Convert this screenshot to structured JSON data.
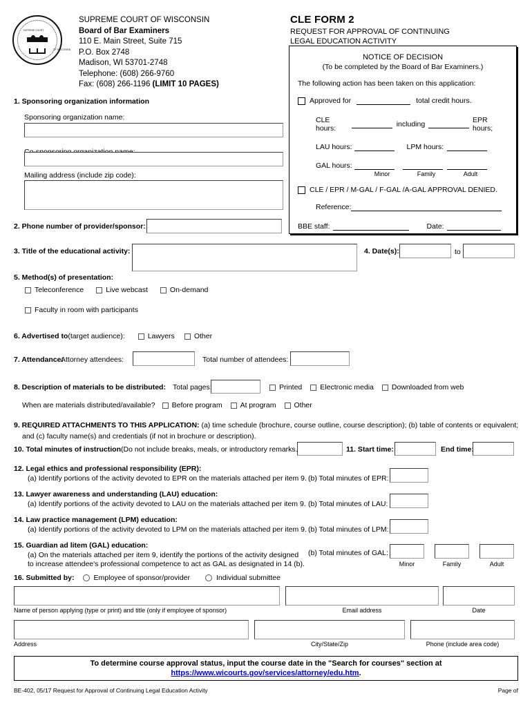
{
  "header": {
    "seal_text_top": "SUPREME COURT",
    "seal_text_bottom": "OF WISCONSIN",
    "court": "SUPREME COURT OF WISCONSIN",
    "board": "Board of Bar Examiners",
    "address1": "110 E. Main Street, Suite 715",
    "address2": "P.O. Box 2748",
    "address3": "Madison, WI  53701-2748",
    "phone": "Telephone: (608) 266-9760",
    "fax": "Fax: (608) 266-1196 ",
    "fax_bold": "(LIMIT 10 PAGES)",
    "form_number": "CLE FORM 2",
    "form_sub1": "REQUEST FOR APPROVAL OF CONTINUING",
    "form_sub2": "LEGAL EDUCATION ACTIVITY"
  },
  "notice": {
    "title": "NOTICE OF DECISION",
    "subtitle": "(To be completed by the Board of Bar Examiners.)",
    "lead": "The following action has been taken on this application:",
    "approved_label": "Approved for",
    "approved_suffix": "total credit hours.",
    "cle_hours_label": "CLE hours:",
    "including_label": "including",
    "epr_hours_label": "EPR hours;",
    "lau_hours_label": "LAU hours:",
    "lpm_hours_label": "LPM hours:",
    "gal_hours_label": "GAL hours:",
    "gal_minor": "Minor",
    "gal_family": "Family",
    "gal_adult": "Adult",
    "denied_label": "CLE / EPR / M-GAL / F-GAL /A-GAL APPROVAL DENIED.",
    "reference_label": "Reference:",
    "bbe_staff_label": "BBE staff:",
    "date_label": "Date:"
  },
  "s1": {
    "heading": "1. Sponsoring organization information",
    "sponsor_label": "Sponsoring organization name:",
    "sponsor_value": "",
    "cosponsor_label": "Co-sponsoring organization name:",
    "cosponsor_value": "",
    "mailing_label": "Mailing address (include zip code):",
    "mailing_value": ""
  },
  "s2": {
    "label": "2. Phone number of provider/sponsor:",
    "value": ""
  },
  "s3": {
    "label": "3. Title of the educational activity:",
    "value": ""
  },
  "s4": {
    "label": "4. Date(s):",
    "from_value": "",
    "to_label": "to",
    "to_value": ""
  },
  "s5": {
    "heading": "5. Method(s) of presentation:",
    "options": [
      {
        "label": "Teleconference",
        "checked": false
      },
      {
        "label": "Live webcast",
        "checked": false
      },
      {
        "label": "On-demand",
        "checked": false
      },
      {
        "label": "Faculty in room with participants",
        "checked": false
      }
    ]
  },
  "s6": {
    "heading": "6. Advertised to ",
    "heading_rest": "(target audience):",
    "options": [
      {
        "label": "Lawyers",
        "checked": false
      },
      {
        "label": "Other",
        "checked": false
      }
    ]
  },
  "s7": {
    "heading": "7. Attendance:",
    "attorney_label": "Attorney attendees:",
    "attorney_value": "",
    "total_label": "Total number of attendees:",
    "total_value": ""
  },
  "s8": {
    "heading": "8. Description of materials to be distributed:",
    "pages_label": "Total pages:",
    "pages_value": "",
    "format_options": [
      {
        "label": "Printed",
        "checked": false
      },
      {
        "label": "Electronic media",
        "checked": false
      },
      {
        "label": "Downloaded from web",
        "checked": false
      }
    ],
    "when_label": "When are materials distributed/available?",
    "when_options": [
      {
        "label": "Before program",
        "checked": false
      },
      {
        "label": "At program",
        "checked": false
      },
      {
        "label": "Other",
        "checked": false
      }
    ]
  },
  "s9": {
    "heading": "9. REQUIRED ATTACHMENTS TO THIS APPLICATION:",
    "line1": " (a) time schedule (brochure, course outline, course description); (b) table of contents or equivalent;",
    "line2": "and (c) faculty name(s) and credentials (if not in brochure or description)."
  },
  "s10": {
    "heading": "10. Total minutes of instruction ",
    "heading_rest": "(Do not include breaks, meals, or introductory remarks.):",
    "value": ""
  },
  "s11": {
    "start_label": "11. Start time:",
    "start_value": "",
    "end_label": "End time:",
    "end_value": ""
  },
  "s12": {
    "heading": "12. Legal ethics and professional responsibility (EPR):",
    "a_text": "(a) Identify portions of the activity devoted to EPR on the materials attached per item 9.",
    "b_label": "(b) Total minutes of EPR:",
    "b_value": ""
  },
  "s13": {
    "heading": "13. Lawyer awareness and understanding (LAU) education:",
    "a_text": "(a) Identify portions of the activity devoted to LAU on the materials attached per item 9.",
    "b_label": "(b) Total minutes of LAU:",
    "b_value": ""
  },
  "s14": {
    "heading": "14. Law practice management (LPM) education:",
    "a_text": "(a) Identify portions of the activity devoted to LPM on the materials attached per item 9.",
    "b_label": "(b) Total minutes of LPM:",
    "b_value": ""
  },
  "s15": {
    "heading": "15. Guardian ad litem (GAL) education:",
    "a_text1": "(a) On the materials attached per item 9, identify the portions of the activity designed",
    "a_text2": "to increase attendee's professional competence to act as GAL as designated in 14 (b).",
    "b_label": "(b) Total minutes of GAL:",
    "minor_label": "Minor",
    "minor_value": "",
    "family_label": "Family",
    "family_value": "",
    "adult_label": "Adult",
    "adult_value": ""
  },
  "s16": {
    "heading": "16. Submitted by:",
    "radio1": "Employee of sponsor/provider",
    "radio2": "Individual submittee",
    "name_value": "",
    "name_caption": "Name of person applying (type or print) and title (only if employee of sponsor)",
    "email_value": "",
    "email_caption": "Email address",
    "date_value": "",
    "date_caption": "Date",
    "address_value": "",
    "address_caption": "Address",
    "citystatezip_value": "",
    "citystatezip_caption": "City/State/Zip",
    "phone_value": "",
    "phone_caption": "Phone (include area code)"
  },
  "footer": {
    "notice_line1": "To determine course approval status, input the course date in the \"Search for courses\" section at",
    "url": "https://www.wicourts.gov/services/attorney/edu.htm",
    "url_period": ".",
    "doc_id": "BE-402, 05/17 Request for Approval of Continuing Legal Education Activity",
    "page": "Page  of",
    "link_color": "#0000cc"
  }
}
